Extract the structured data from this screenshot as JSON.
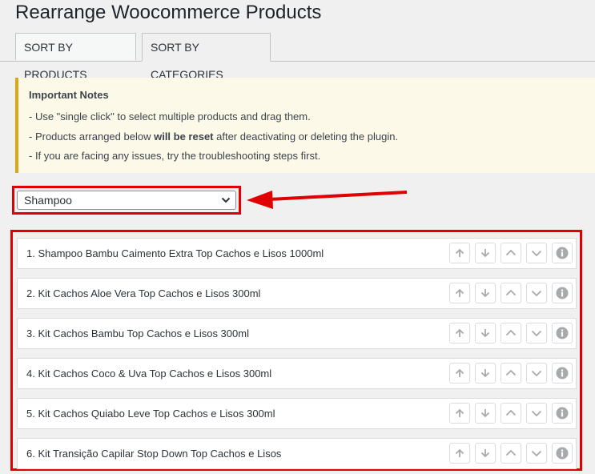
{
  "page": {
    "title": "Rearrange Woocommerce Products"
  },
  "tabs": [
    {
      "label": "SORT BY PRODUCTS",
      "active": false
    },
    {
      "label": "SORT BY CATEGORIES",
      "active": true
    }
  ],
  "notice": {
    "heading": "Important Notes",
    "line1": "- Use \"single click\" to select multiple products and drag them.",
    "line2_pre": "- Products arranged below ",
    "line2_bold": "will be reset",
    "line2_post": " after deactivating or deleting the plugin.",
    "line3": "- If you are facing any issues, try the troubleshooting steps first."
  },
  "category_select": {
    "selected": "Shampoo"
  },
  "products": [
    {
      "label": "1. Shampoo Bambu Caimento Extra Top Cachos e Lisos 1000ml"
    },
    {
      "label": "2. Kit Cachos Aloe Vera Top Cachos e Lisos 300ml"
    },
    {
      "label": "3. Kit Cachos Bambu Top Cachos e Lisos 300ml"
    },
    {
      "label": "4. Kit Cachos Coco & Uva Top Cachos e Lisos 300ml"
    },
    {
      "label": "5. Kit Cachos Quiabo Leve Top Cachos e Lisos 300ml"
    },
    {
      "label": "6. Kit Transição Capilar Stop Down Top Cachos e Lisos"
    }
  ],
  "row_buttons": [
    "move-to-top-icon",
    "move-to-bottom-icon",
    "move-up-icon",
    "move-down-icon",
    "info-icon"
  ],
  "colors": {
    "highlight": "#e00000",
    "notice_border": "#dba617",
    "icon": "#a7aaad"
  }
}
